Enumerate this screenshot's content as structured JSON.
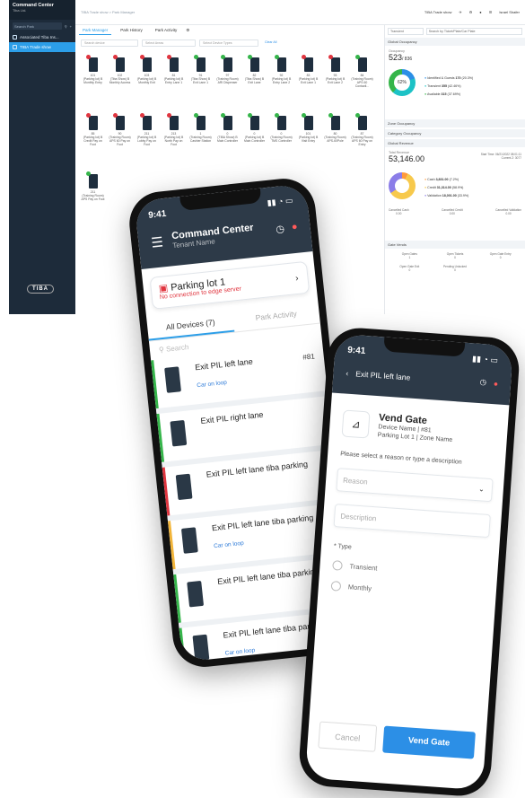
{
  "desktop": {
    "sidebar": {
      "title": "Command Center",
      "subtitle": "Tiba Ltd.",
      "search_placeholder": "Search Park",
      "items": [
        {
          "label": "Associated Tiba Ins..."
        },
        {
          "label": "TIBA Trade show"
        }
      ],
      "logo": "TIBA"
    },
    "topbar": {
      "breadcrumb": "TIBA Trade show  >  Park Manager",
      "user_area": "TIBA Trade show",
      "user": "Israel Shafer"
    },
    "tabs": [
      "Park Manager",
      "Park History",
      "Park Activity"
    ],
    "filters": [
      "Search device",
      "Select Areas",
      "Select Device Types",
      "Clear All"
    ],
    "devices": [
      {
        "id": "101",
        "name": "(Parking lot) B Monthly Entry",
        "status": "red"
      },
      {
        "id": "102",
        "name": "(Tiba Show) B Monthly Access",
        "status": "red"
      },
      {
        "id": "103",
        "name": "(Parking lot) B Monthly Exit",
        "status": "red"
      },
      {
        "id": "81",
        "name": "(Parking lot) B Entry Lane 1",
        "status": "red"
      },
      {
        "id": "91",
        "name": "(Tiba Show) B Exit Lane 1",
        "status": "green"
      },
      {
        "id": "97",
        "name": "(Training Room) ARI Dispenser",
        "status": "green"
      },
      {
        "id": "82",
        "name": "(Tiba Show) B Exit Lane",
        "status": "green"
      },
      {
        "id": "92",
        "name": "(Parking lot) B Entry Lane 2",
        "status": "green"
      },
      {
        "id": "83",
        "name": "(Parking lot) B Exit Lane 1",
        "status": "red"
      },
      {
        "id": "93",
        "name": "(Parking lot) B Exit Lane 2",
        "status": "red"
      },
      {
        "id": "84",
        "name": "(Training Room) APS 60 Contactl...",
        "status": "green"
      },
      {
        "id": "85",
        "name": "(Parking lot) B Credit Pay on Foot",
        "status": "red"
      },
      {
        "id": "90",
        "name": "(Training Room) APS 60 Pay on Foot",
        "status": "red"
      },
      {
        "id": "211",
        "name": "(Parking lot) B Lobby Pay on Foot",
        "status": "red"
      },
      {
        "id": "213",
        "name": "(Parking lot) B North Pay on Foot",
        "status": "red"
      },
      {
        "id": "1",
        "name": "(Training Room) Cashier Station",
        "status": "green"
      },
      {
        "id": "0",
        "name": "(TIBA Show) B Main Controller",
        "status": "green"
      },
      {
        "id": "0",
        "name": "(Parking lot) B Main Controller",
        "status": "green"
      },
      {
        "id": "0",
        "name": "(Training Room) TMS Controller",
        "status": "green"
      },
      {
        "id": "101",
        "name": "(Parking lot) B Visit Entry",
        "status": "green"
      },
      {
        "id": "80",
        "name": "(Training Room) APS-60Pole",
        "status": "green"
      },
      {
        "id": "87",
        "name": "(Training Room) APS 60 Pay on Entry",
        "status": "green"
      },
      {
        "id": "211",
        "name": "(Training Room) APS Pay on Foot",
        "status": "green"
      }
    ],
    "right_panel": {
      "select_1": "Transient",
      "select_2": "Search by Ticket/Plate/Car Plate",
      "global_occupancy_label": "Global Occupancy",
      "occupancy_label": "Occupancy",
      "occupancy": "523",
      "capacity": "/ 836",
      "percent": "62%",
      "legend": [
        {
          "label": "Identified & Guests",
          "value": "170",
          "pct": "(20.3%)",
          "color": "#2c8fe6"
        },
        {
          "label": "Transient",
          "value": "355",
          "pct": "(42.46%)",
          "color": "#1dc2c6"
        },
        {
          "label": "Available",
          "value": "315",
          "pct": "(37.69%)",
          "color": "#35b54a"
        }
      ],
      "zone_occupancy": "Zone Occupancy",
      "category_occupancy": "Category Occupancy",
      "global_revenue": "Global Revenue",
      "total_revenue_label": "Total Revenue",
      "total_revenue": "53,146.00",
      "start_time": "Start Time: 06/21/2022 08:01:11",
      "current_z": "Current Z: 3077",
      "revenue_legend": [
        {
          "label": "Cash",
          "value": "3,831.00",
          "pct": "(7.2%)",
          "color": "#ff9a3c"
        },
        {
          "label": "Credit",
          "value": "31,314.00",
          "pct": "(58.9%)",
          "color": "#f7c94c"
        },
        {
          "label": "Validation",
          "value": "18,001.00",
          "pct": "(33.9%)",
          "color": "#8b7de8"
        }
      ],
      "cancelled": [
        {
          "label": "Cancelled Cash",
          "value": "0.00"
        },
        {
          "label": "Cancelled Credit",
          "value": "0.00"
        },
        {
          "label": "Cancelled Validation",
          "value": "0.00"
        }
      ],
      "gate_vends": "Gate Vends",
      "vends": [
        {
          "label": "Open Gates",
          "value": "1"
        },
        {
          "label": "Open Tickets",
          "value": "0"
        },
        {
          "label": "Open Gate Entry",
          "value": "0"
        },
        {
          "label": "Open Gate Exit",
          "value": "0"
        },
        {
          "label": "Pending Unlocked",
          "value": "0"
        }
      ]
    }
  },
  "phone1": {
    "time": "9:41",
    "title": "Command Center",
    "subtitle": "Tenant Name",
    "lot_name": "Parking lot 1",
    "lot_error": "No connection to edge server",
    "tab_devices": "All Devices (7)",
    "tab_activity": "Park Activity",
    "search": "Search",
    "rows": [
      {
        "name": "Exit PIL left lane",
        "num": "#81",
        "loop": "Car on loop",
        "color": "#35b54a"
      },
      {
        "name": "Exit PIL right lane",
        "num": "",
        "loop": "",
        "color": "#35b54a"
      },
      {
        "name": "Exit PIL left lane tiba parking",
        "num": "",
        "loop": "",
        "color": "#e0353f"
      },
      {
        "name": "Exit PIL left lane tiba parking",
        "num": "",
        "loop": "Car on loop",
        "color": "#f2b53a"
      },
      {
        "name": "Exit PIL left lane tiba parking",
        "num": "",
        "loop": "",
        "color": "#35b54a"
      },
      {
        "name": "Exit PIL left lane tiba parking",
        "num": "",
        "loop": "Car on loop",
        "color": "#35b54a"
      },
      {
        "name": "Exit PIL left lane tiba parking",
        "num": "",
        "loop": "",
        "color": "#35b54a"
      }
    ]
  },
  "phone2": {
    "time": "9:41",
    "title": "Exit PIL left lane",
    "vend_title": "Vend Gate",
    "device_line": "Device Name | #81",
    "lot_line": "Parking Lot 1 | Zone Name",
    "prompt": "Please select a reason or type a description",
    "reason_placeholder": "Reason",
    "description_placeholder": "Description",
    "type_label": "Type",
    "options": [
      "Transient",
      "Monthly"
    ],
    "cancel": "Cancel",
    "vend": "Vend Gate"
  }
}
